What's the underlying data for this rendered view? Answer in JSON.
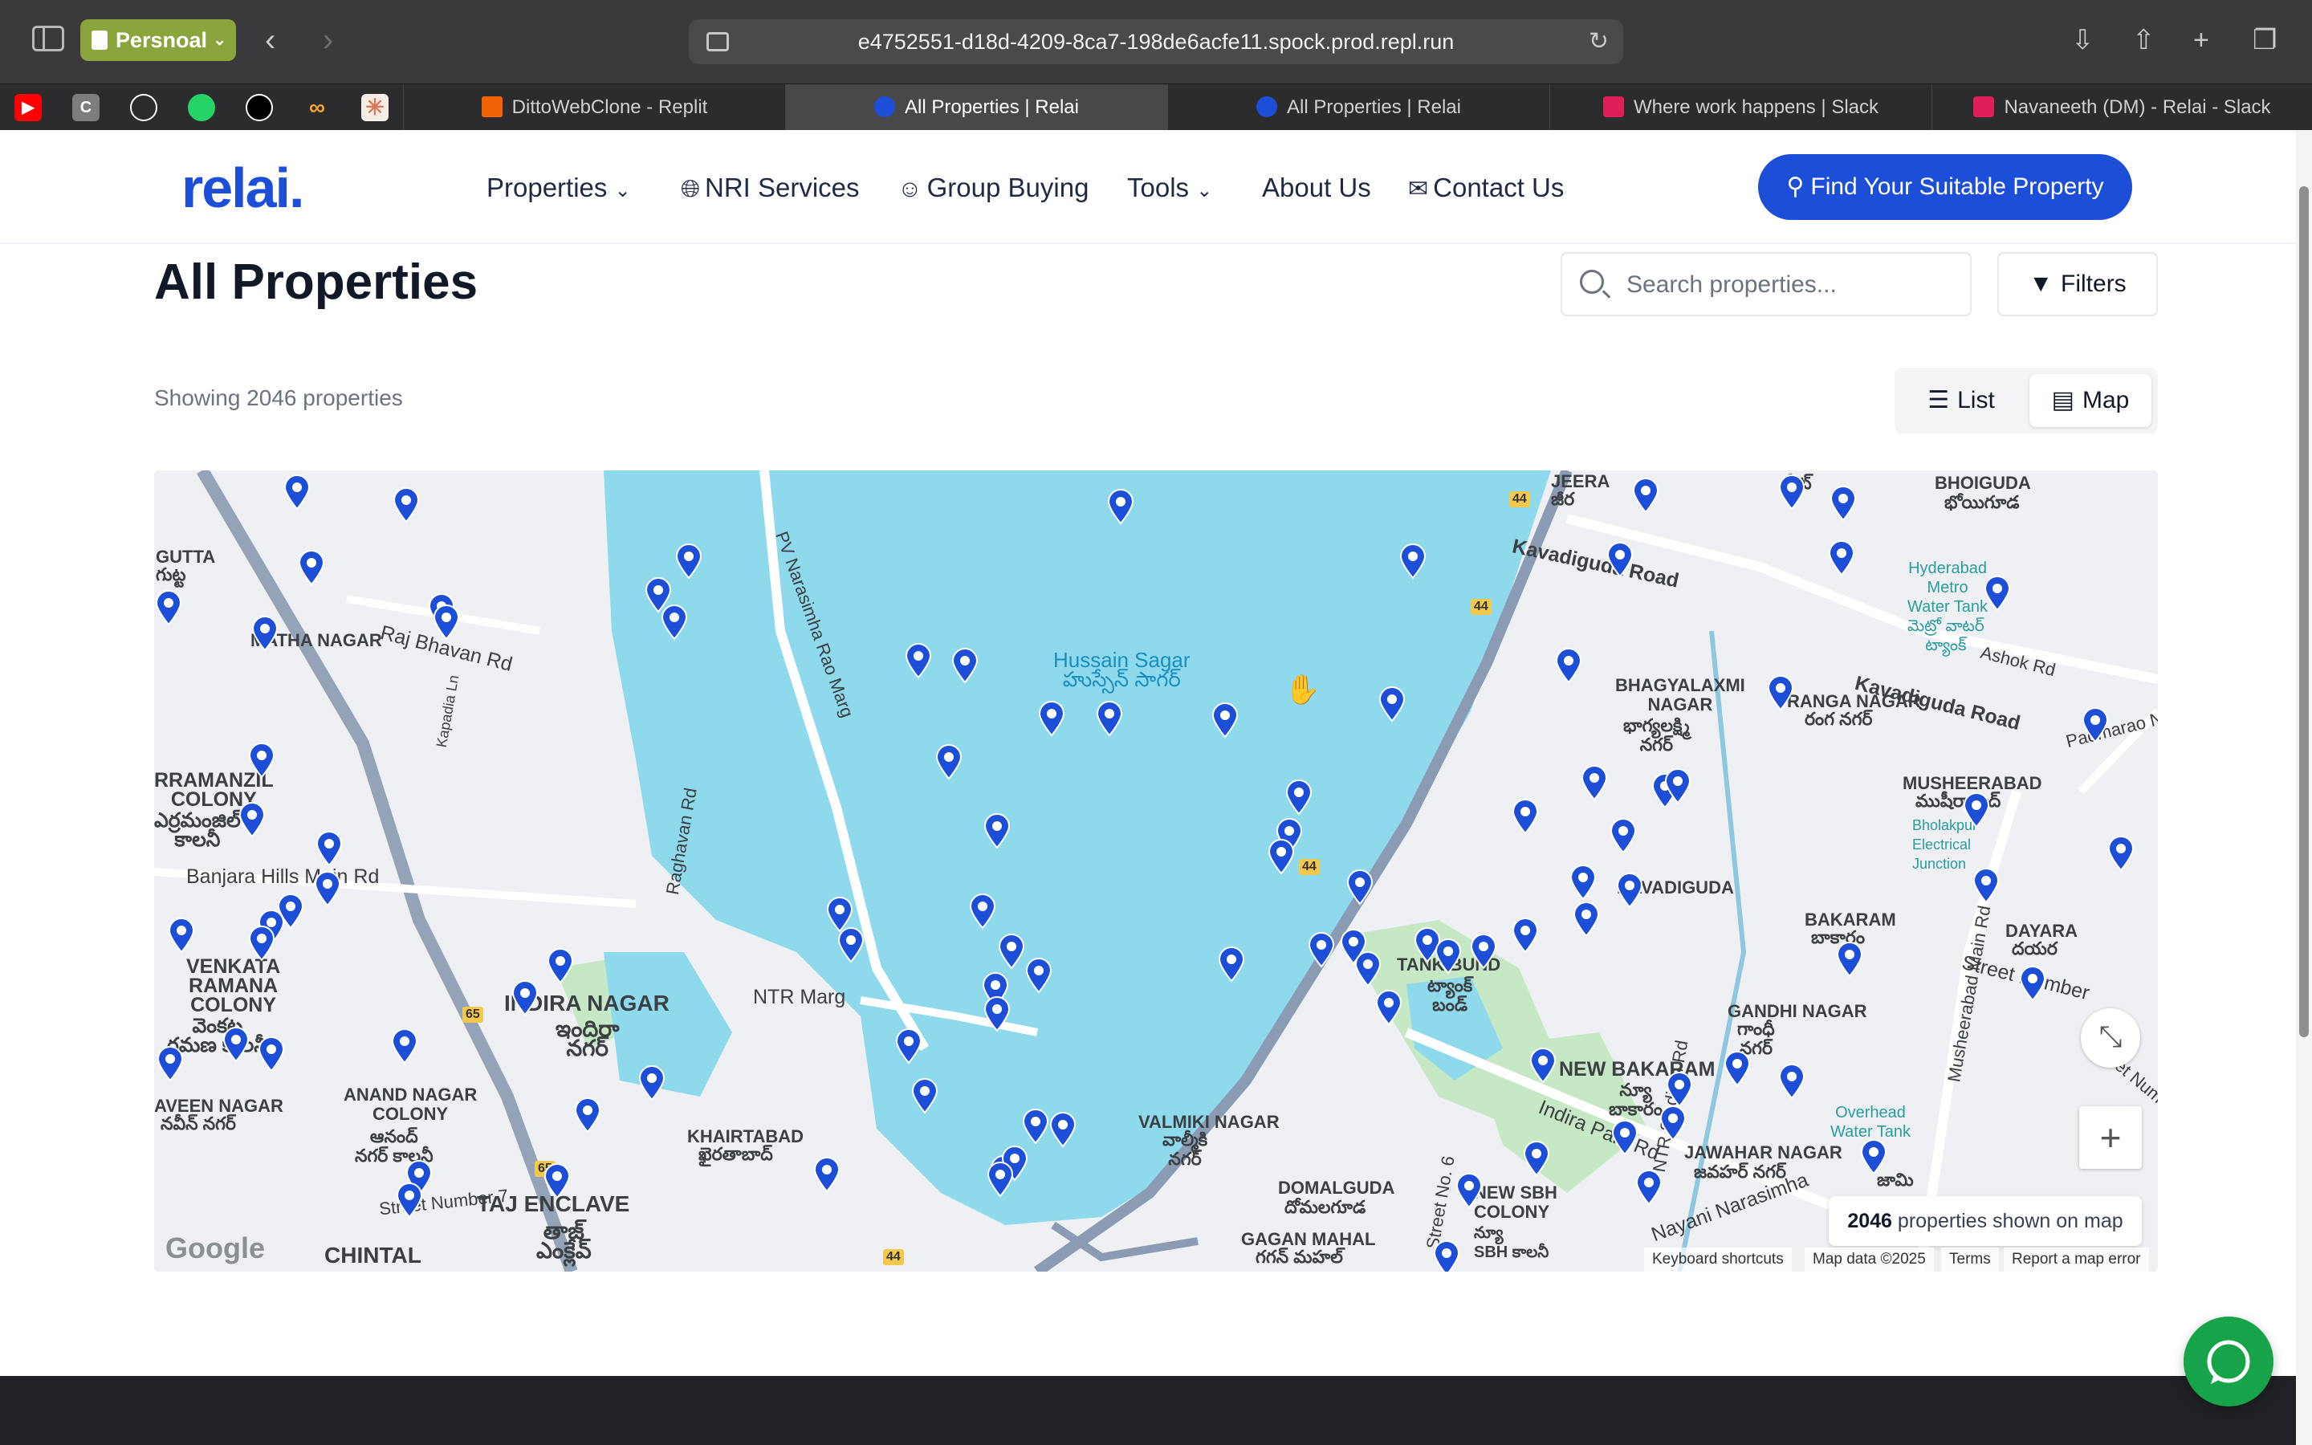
{
  "browser": {
    "profile_label": "Persnoal",
    "url": "e4752551-d18d-4209-8ca7-198de6acfe11.spock.prod.repl.run",
    "tabs": [
      {
        "title": "DittoWebClone - Replit",
        "color": "#f26207"
      },
      {
        "title": "All Properties | Relai",
        "color": "#1d4ed8",
        "active": true
      },
      {
        "title": "All Properties | Relai",
        "color": "#1d4ed8"
      },
      {
        "title": "Where work happens | Slack",
        "color": "#e01e5a"
      },
      {
        "title": "Navaneeth (DM) - Relai - Slack",
        "color": "#e01e5a"
      }
    ],
    "bookmark_icons": [
      "youtube-icon",
      "c-icon",
      "github-icon",
      "whatsapp-icon",
      "openai-icon",
      "infinity-icon",
      "claude-icon"
    ]
  },
  "header": {
    "logo": "relai.",
    "nav": {
      "properties": "Properties",
      "nri": "NRI Services",
      "group": "Group Buying",
      "tools": "Tools",
      "about": "About Us",
      "contact": "Contact Us"
    },
    "cta": "Find Your Suitable Property"
  },
  "page": {
    "title": "All Properties",
    "search_placeholder": "Search properties...",
    "filters_label": "Filters",
    "count_text": "Showing 2046 properties",
    "view_list": "List",
    "view_map": "Map"
  },
  "map": {
    "count_number": "2046",
    "count_suffix": " properties shown on map",
    "zoom_in": "+",
    "google": "Google",
    "footer": {
      "shortcuts": "Keyboard shortcuts",
      "data": "Map data ©2025",
      "terms": "Terms",
      "report": "Report a map error"
    },
    "labels": {
      "lake_en": "Hussain Sagar",
      "lake_te": "హుస్సేన్ సాగర్",
      "jeera": "JEERA",
      "jeera_te": "జీర",
      "bhoiguda": "BHOIGUDA",
      "bhoiguda_te": "భోయిగూడ",
      "kavadiguda_rd": "Kavadiguda Road",
      "kavadiguda_rd2": "Kavadiguda Road",
      "hyd_tank": "Hyderabad\nMetro\nWater Tank",
      "ashok": "Ashok Rd",
      "padmarao": "Padmarao Na",
      "bhagyalaxmi": "BHAGYALAXMI\nNAGAR",
      "bhagyalaxmi_te": "భాగ్యలక్ష్మి\nనగర్",
      "ranga": "RANGA NAGAR",
      "ranga_te": "రంగ నగర్",
      "musheerabad": "MUSHEERABAD",
      "musheerabad_te": "ముషీరాబాద్",
      "bholakpur": "Bholakpur\nElectrical\nJunction",
      "musheerabad_rd": "Musheerabad Main Rd",
      "kavadiguda": "KAVADIGUDA",
      "bakaram": "BAKARAM",
      "bakaram_te": "బాకారం",
      "dayara": "DAYARA",
      "dayara_te": "దయర",
      "street_no": "Street Number",
      "gandhi": "GANDHI NAGAR",
      "gandhi_te": "గాంధీ\nనగర్",
      "new_bakaram": "NEW BAKARAM",
      "new_bakaram_te": "న్యూ\nబాకారం",
      "overhead": "Overhead\nWater Tank",
      "jawahar": "JAWAHAR NAGAR",
      "jawahar_te": "జవహర్ నగర్",
      "tank_bund": "TANK BUND",
      "tank_bund_te": "ట్యాంక్\nబండ్",
      "ntr_stadium": "NTR Stadium Rd",
      "indira_park": "Indira Park Rd",
      "valmiki": "VALMIKI NAGAR",
      "valmiki_te": "వాల్మీకి\nనగర్",
      "domalguda": "DOMALGUDA",
      "domalguda_te": "దోమలగూడ",
      "new_sbh": "NEW SBH\nCOLONY",
      "new_sbh_te": "న్యూ\nSBH కాలనీ",
      "gagan": "GAGAN MAHAL",
      "gagan_te": "గగన్ మహల్",
      "nayani": "Nayani Narasimha",
      "street6": "Street No. 6",
      "ntr_marg": "NTR Marg",
      "indira_nagar": "INDIRA NAGAR",
      "indira_nagar_te": "ఇందిరా\nనగర్",
      "khairtabad": "KHAIRTABAD",
      "khairtabad_te": "ఖైరతాబాద్",
      "taj": "TAJ ENCLAVE",
      "taj_te": "తాజ్\nఎంక్లేవ్",
      "chintal": "CHINTAL",
      "anand": "ANAND NAGAR\nCOLONY",
      "anand_te": "ఆనంద్\nనగర్ కాలనీ",
      "naveen": "AVEEN NAGAR",
      "naveen_te": "నవీన్ నగర్",
      "street7": "Street Number 7",
      "venkata": "VENKATA\nRAMANA\nCOLONY",
      "venkata_te": "వెంకట\nరమణ కాలనీ",
      "banjara": "Banjara Hills Main Rd",
      "erramanzil": "RRAMANZIL\nCOLONY",
      "erramanzil_te": "ఎర్రమంజిల్\nకాలనీ",
      "matha": "MATHA NAGAR",
      "raj_bhavan": "Raj Bhavan Rd",
      "kapadia": "Kapadia Ln",
      "pv_marg": "PV Narasimha Rao Marg",
      "raghavan": "Raghavan Rd",
      "gutta": "GUTTA",
      "gutta_te": "గుట్ట",
      "peth": "పేట్",
      "water_tank_te": "మెట్రో వాటర్\nట్యాంక్",
      "street_num2": "Street Numb",
      "jami": "జామి"
    },
    "highways": [
      "44",
      "44",
      "44",
      "44",
      "65",
      "65"
    ]
  },
  "colors": {
    "brand": "#1d4ed8",
    "water": "#8fd9ec",
    "chat": "#16a34a"
  }
}
